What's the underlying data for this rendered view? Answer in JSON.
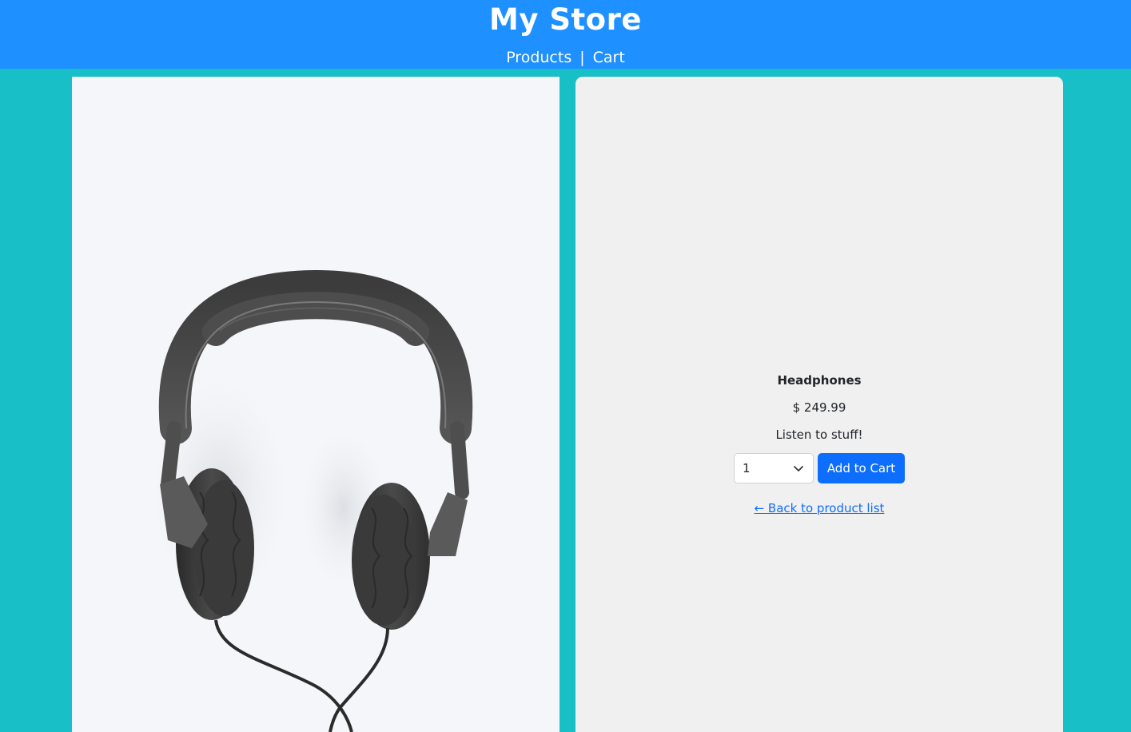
{
  "header": {
    "title": "My Store",
    "nav": {
      "products": "Products",
      "separator": "|",
      "cart": "Cart"
    }
  },
  "product": {
    "image_alt": "headphones-photo",
    "name": "Headphones",
    "price": "$ 249.99",
    "description": "Listen to stuff!",
    "quantity": {
      "selected": "1",
      "icon": "chevron-down-icon"
    },
    "add_to_cart_label": "Add to Cart",
    "back_link": "← Back to product list"
  },
  "colors": {
    "page_background": "#19bfc6",
    "header_background": "#1e90ff",
    "header_text": "#ffffff",
    "button_primary": "#0d6efd",
    "link": "#0d6efd",
    "details_panel": "#f0f0f0",
    "image_panel": "#f4f6f9"
  }
}
